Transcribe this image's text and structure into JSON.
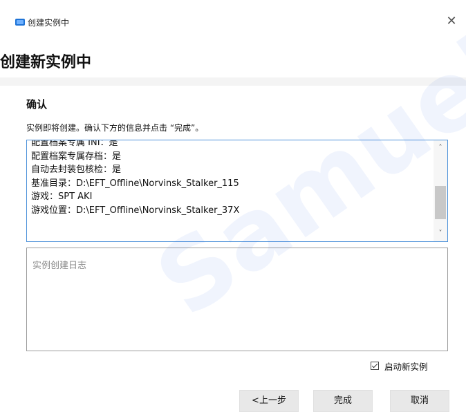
{
  "window": {
    "title": "创建实例中",
    "close_glyph": "✕"
  },
  "page": {
    "heading": "创建新实例中"
  },
  "confirm": {
    "heading": "确认",
    "description": "实例即将创建。确认下方的信息并点击 “完成”。"
  },
  "summary_lines": [
    "配置档案专属 INI：是",
    "配置档案专属存档：是",
    "自动去封装包核检：是",
    "基准目录：D:\\EFT_Offline\\Norvinsk_Stalker_115",
    "游戏：SPT AKI",
    "游戏位置：D:\\EFT_Offline\\Norvinsk_Stalker_37X"
  ],
  "scroll": {
    "up_glyph": "˄",
    "down_glyph": "˅"
  },
  "log": {
    "placeholder": "实例创建日志"
  },
  "launch": {
    "label": "启动新实例",
    "checked": true
  },
  "buttons": {
    "back": "<上一步",
    "finish": "完成",
    "cancel": "取消"
  },
  "watermark": "Samuel是",
  "colors": {
    "accent": "#4a90d9",
    "icon": "#1e73d6"
  }
}
